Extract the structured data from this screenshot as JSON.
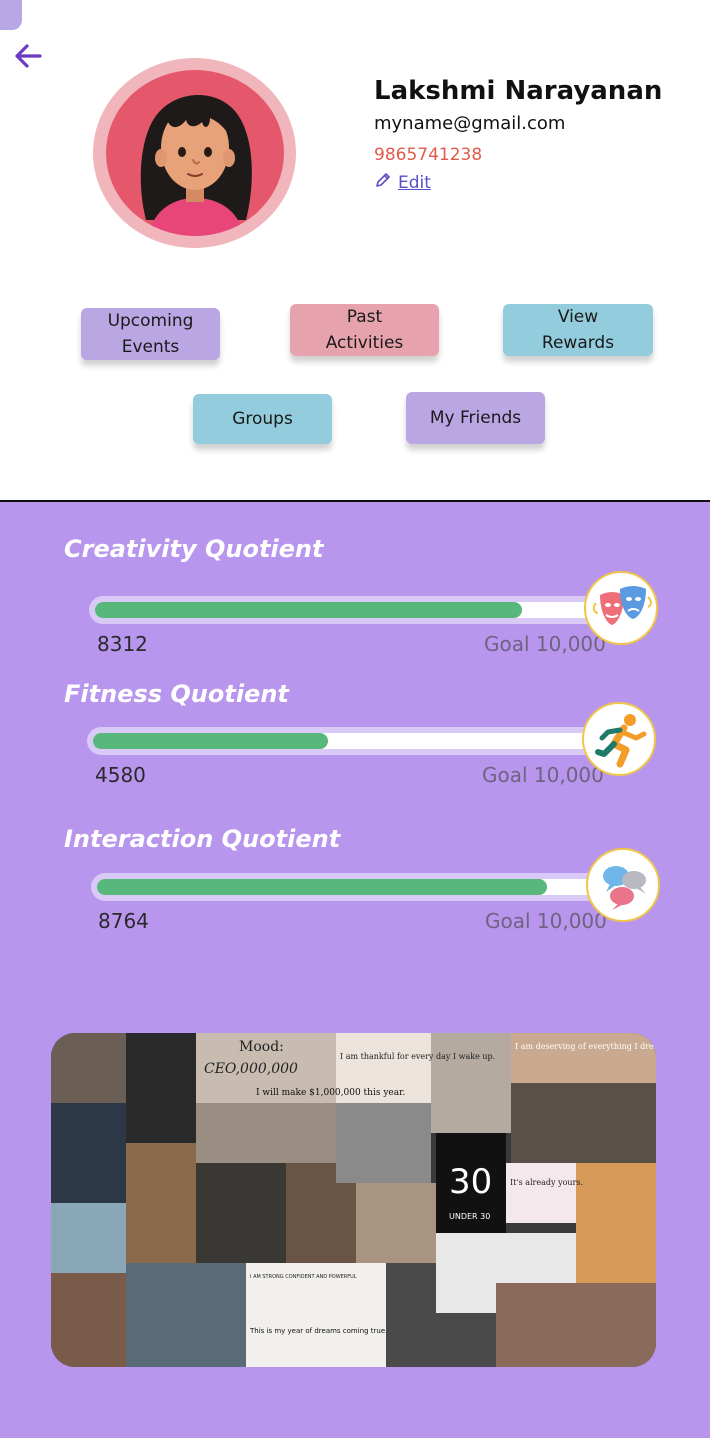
{
  "profile": {
    "name": "Lakshmi Narayanan",
    "email": "myname@gmail.com",
    "phone": "9865741238",
    "edit_label": "Edit"
  },
  "actions": {
    "upcoming": "Upcoming\nEvents",
    "past": "Past\nActivities",
    "rewards": "View\nRewards",
    "groups": "Groups",
    "friends": "My Friends"
  },
  "quotients": [
    {
      "title": "Creativity Quotient",
      "value": "8312",
      "goal": "Goal 10,000",
      "progress": 0.8312,
      "icon": "theater-masks-icon"
    },
    {
      "title": "Fitness Quotient",
      "value": "4580",
      "goal": "Goal 10,000",
      "progress": 0.458,
      "icon": "running-person-icon"
    },
    {
      "title": "Interaction Quotient",
      "value": "8764",
      "goal": "Goal 10,000",
      "progress": 0.8764,
      "icon": "chat-bubbles-icon"
    }
  ],
  "vision_board": {
    "texts": [
      "Mood:",
      "CEO,000,000",
      "I will make $1,000,000 this year.",
      "I am thankful for every day I wake up.",
      "I am deserving of everything I dream of.",
      "30",
      "UNDER 30",
      "It's already yours.",
      "I AM STRONG CONFIDENT AND POWERFUL",
      "This is my year of dreams coming true."
    ]
  },
  "colors": {
    "accent": "#b896ee",
    "progress": "#58b77a",
    "phone": "#e05a4a",
    "link": "#5a4fc4"
  }
}
